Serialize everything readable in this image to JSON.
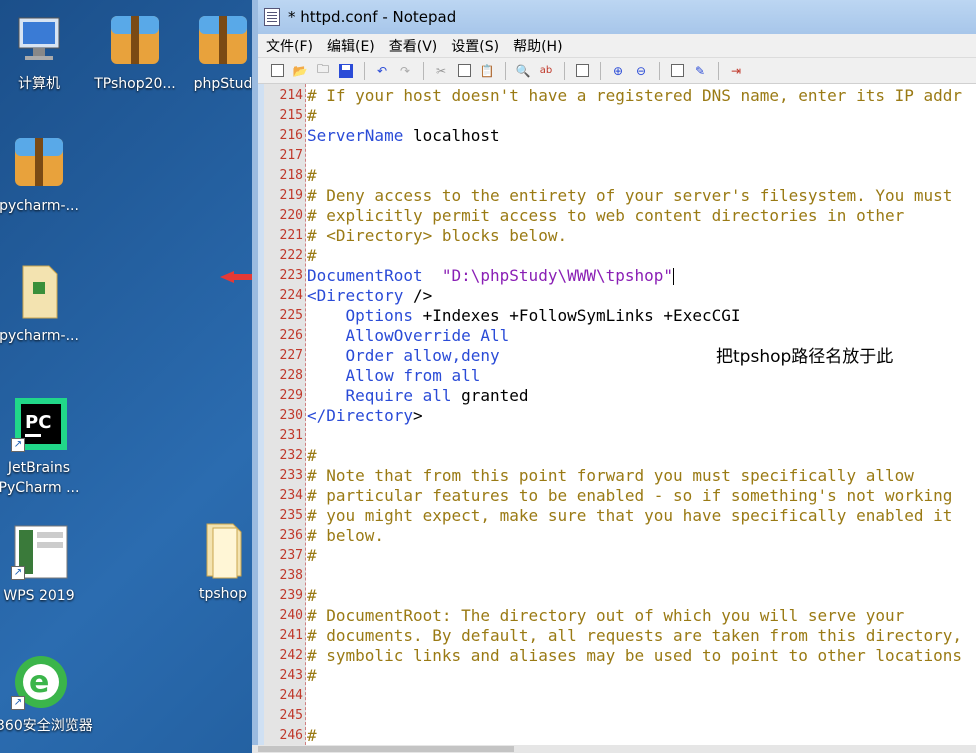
{
  "desktop": {
    "icons": [
      {
        "label": "计算机",
        "icon": "computer-icon"
      },
      {
        "label": "TPshop20...",
        "icon": "archive-icon"
      },
      {
        "label": "phpStud",
        "icon": "archive-icon"
      },
      {
        "label": "pycharm-...",
        "icon": "archive-icon"
      },
      {
        "label": "pycharm-...",
        "icon": "folder-icon"
      },
      {
        "label": "JetBrains PyCharm ...",
        "icon": "pycharm-icon"
      },
      {
        "label": "WPS 2019",
        "icon": "wps-icon"
      },
      {
        "label": "tpshop",
        "icon": "folder-icon"
      },
      {
        "label": "360安全浏览器",
        "icon": "browser-360-icon"
      }
    ]
  },
  "window": {
    "title": "* httpd.conf - Notepad",
    "menu": [
      "文件(F)",
      "编辑(E)",
      "查看(V)",
      "设置(S)",
      "帮助(H)"
    ],
    "toolbar": [
      "new-icon",
      "open-icon",
      "open-folder-icon",
      "save-icon",
      "undo-icon",
      "redo-icon",
      "cut-icon",
      "copy-icon",
      "paste-icon",
      "find-icon",
      "replace-icon",
      "view-icon",
      "zoom-in-icon",
      "zoom-out-icon",
      "settings-icon",
      "edit-icon",
      "exit-icon"
    ]
  },
  "editor": {
    "annotation": "把tpshop路径名放于此",
    "lines": [
      {
        "n": "214",
        "text": "# If your host doesn't have a registered DNS name, enter its IP addr"
      },
      {
        "n": "215",
        "text": "#"
      },
      {
        "n": "216",
        "kw": "ServerName",
        "rest": " localhost"
      },
      {
        "n": "217",
        "text": ""
      },
      {
        "n": "218",
        "text": "#"
      },
      {
        "n": "219",
        "text": "# Deny access to the entirety of your server's filesystem. You must"
      },
      {
        "n": "220",
        "text": "# explicitly permit access to web content directories in other"
      },
      {
        "n": "221",
        "text": "# <Directory> blocks below."
      },
      {
        "n": "222",
        "text": "#"
      },
      {
        "n": "223",
        "kw": "DocumentRoot",
        "str": "  \"D:\\phpStudy\\WWW\\tpshop\""
      },
      {
        "n": "224",
        "kw": "<Directory",
        "rest": " />"
      },
      {
        "n": "225",
        "kw": "    Options",
        "rest": " +Indexes +FollowSymLinks +ExecCGI"
      },
      {
        "n": "226",
        "kw": "    AllowOverride All",
        "rest": ""
      },
      {
        "n": "227",
        "kw": "    Order allow,deny",
        "rest": ""
      },
      {
        "n": "228",
        "kw": "    Allow from all",
        "rest": ""
      },
      {
        "n": "229",
        "kw": "    Require all",
        "rest": " granted"
      },
      {
        "n": "230",
        "kw": "</Directory",
        "rest": ">"
      },
      {
        "n": "231",
        "text": ""
      },
      {
        "n": "232",
        "text": "#"
      },
      {
        "n": "233",
        "text": "# Note that from this point forward you must specifically allow"
      },
      {
        "n": "234",
        "text": "# particular features to be enabled - so if something's not working"
      },
      {
        "n": "235",
        "text": "# you might expect, make sure that you have specifically enabled it"
      },
      {
        "n": "236",
        "text": "# below."
      },
      {
        "n": "237",
        "text": "#"
      },
      {
        "n": "238",
        "text": ""
      },
      {
        "n": "239",
        "text": "#"
      },
      {
        "n": "240",
        "text": "# DocumentRoot: The directory out of which you will serve your"
      },
      {
        "n": "241",
        "text": "# documents. By default, all requests are taken from this directory,"
      },
      {
        "n": "242",
        "text": "# symbolic links and aliases may be used to point to other locations"
      },
      {
        "n": "243",
        "text": "#"
      },
      {
        "n": "244",
        "text": ""
      },
      {
        "n": "245",
        "text": ""
      },
      {
        "n": "246",
        "text": "#"
      }
    ]
  }
}
